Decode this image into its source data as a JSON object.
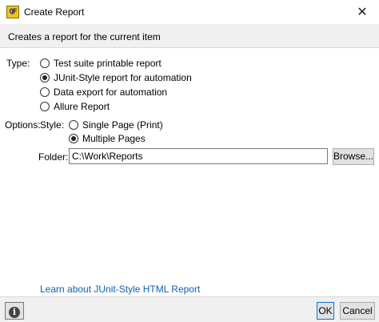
{
  "window": {
    "title": "Create Report",
    "app_icon_text": "QF",
    "close_symbol": "✕"
  },
  "header": {
    "description": "Creates a report for the current item"
  },
  "type_section": {
    "label": "Type:",
    "options": [
      {
        "label": "Test suite printable report",
        "checked": false
      },
      {
        "label": "JUnit-Style report for automation",
        "checked": true
      },
      {
        "label": "Data export for automation",
        "checked": false
      },
      {
        "label": "Allure Report",
        "checked": false
      }
    ]
  },
  "options_section": {
    "label": "Options:",
    "style_label": "Style:",
    "style_options": [
      {
        "label": "Single Page (Print)",
        "checked": false
      },
      {
        "label": "Multiple Pages",
        "checked": true
      }
    ],
    "folder_label": "Folder:",
    "folder_value": "C:\\Work\\Reports",
    "browse_label": "Browse..."
  },
  "link": {
    "text": "Learn about JUnit-Style HTML Report"
  },
  "footer": {
    "info_symbol": "i",
    "ok_label": "OK",
    "cancel_label": "Cancel"
  },
  "colors": {
    "link": "#0f5fb8",
    "default_button_border": "#0078d7"
  }
}
